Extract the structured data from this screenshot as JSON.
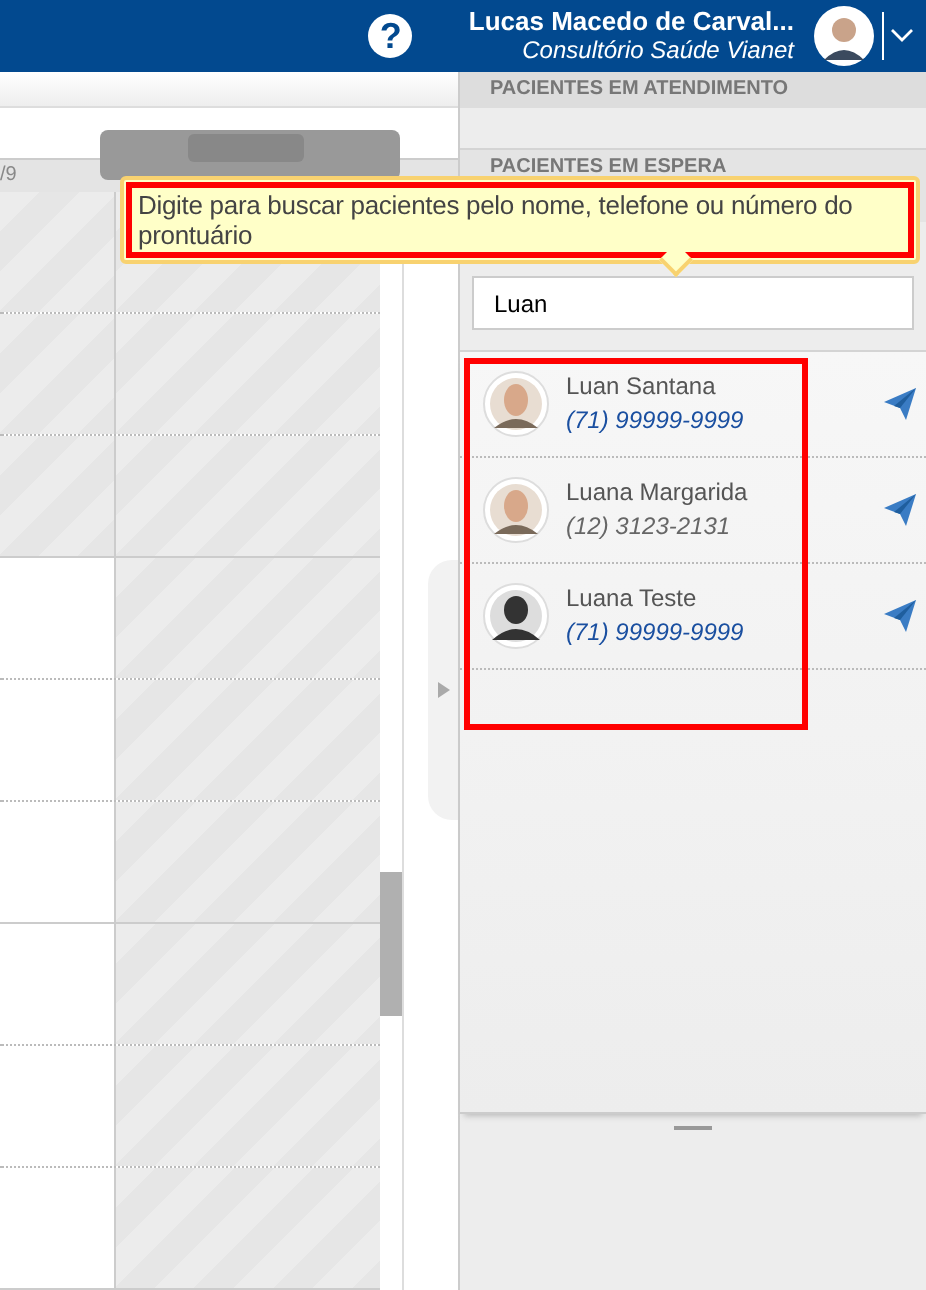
{
  "header": {
    "help_glyph": "?",
    "user_name": "Lucas Macedo de Carval...",
    "clinic": "Consultório Saúde Vianet"
  },
  "calendar": {
    "column_header": "/9",
    "rows": [
      {
        "shaded": true,
        "kind": "dotted"
      },
      {
        "shaded": true,
        "kind": "dotted"
      },
      {
        "shaded": true,
        "kind": "solid"
      },
      {
        "shaded": false,
        "kind": "dotted"
      },
      {
        "shaded": false,
        "kind": "dotted"
      },
      {
        "shaded": false,
        "kind": "solid"
      },
      {
        "shaded": false,
        "kind": "dotted"
      },
      {
        "shaded": false,
        "kind": "dotted"
      },
      {
        "shaded": false,
        "kind": "solid"
      }
    ]
  },
  "panel": {
    "sections": [
      "PACIENTES EM ATENDIMENTO",
      "PACIENTES EM ESPERA"
    ],
    "tooltip": "Digite para buscar pacientes pelo nome, telefone ou número do prontuário",
    "search": {
      "value": "Luan"
    },
    "patients": [
      {
        "name": "Luan Santana",
        "phone": "(71) 99999-9999",
        "linked": true,
        "kind": "photo"
      },
      {
        "name": "Luana Margarida",
        "phone": "(12) 3123-2131",
        "linked": false,
        "kind": "photo"
      },
      {
        "name": "Luana Teste",
        "phone": "(71) 99999-9999",
        "linked": true,
        "kind": "silhouette"
      }
    ]
  }
}
